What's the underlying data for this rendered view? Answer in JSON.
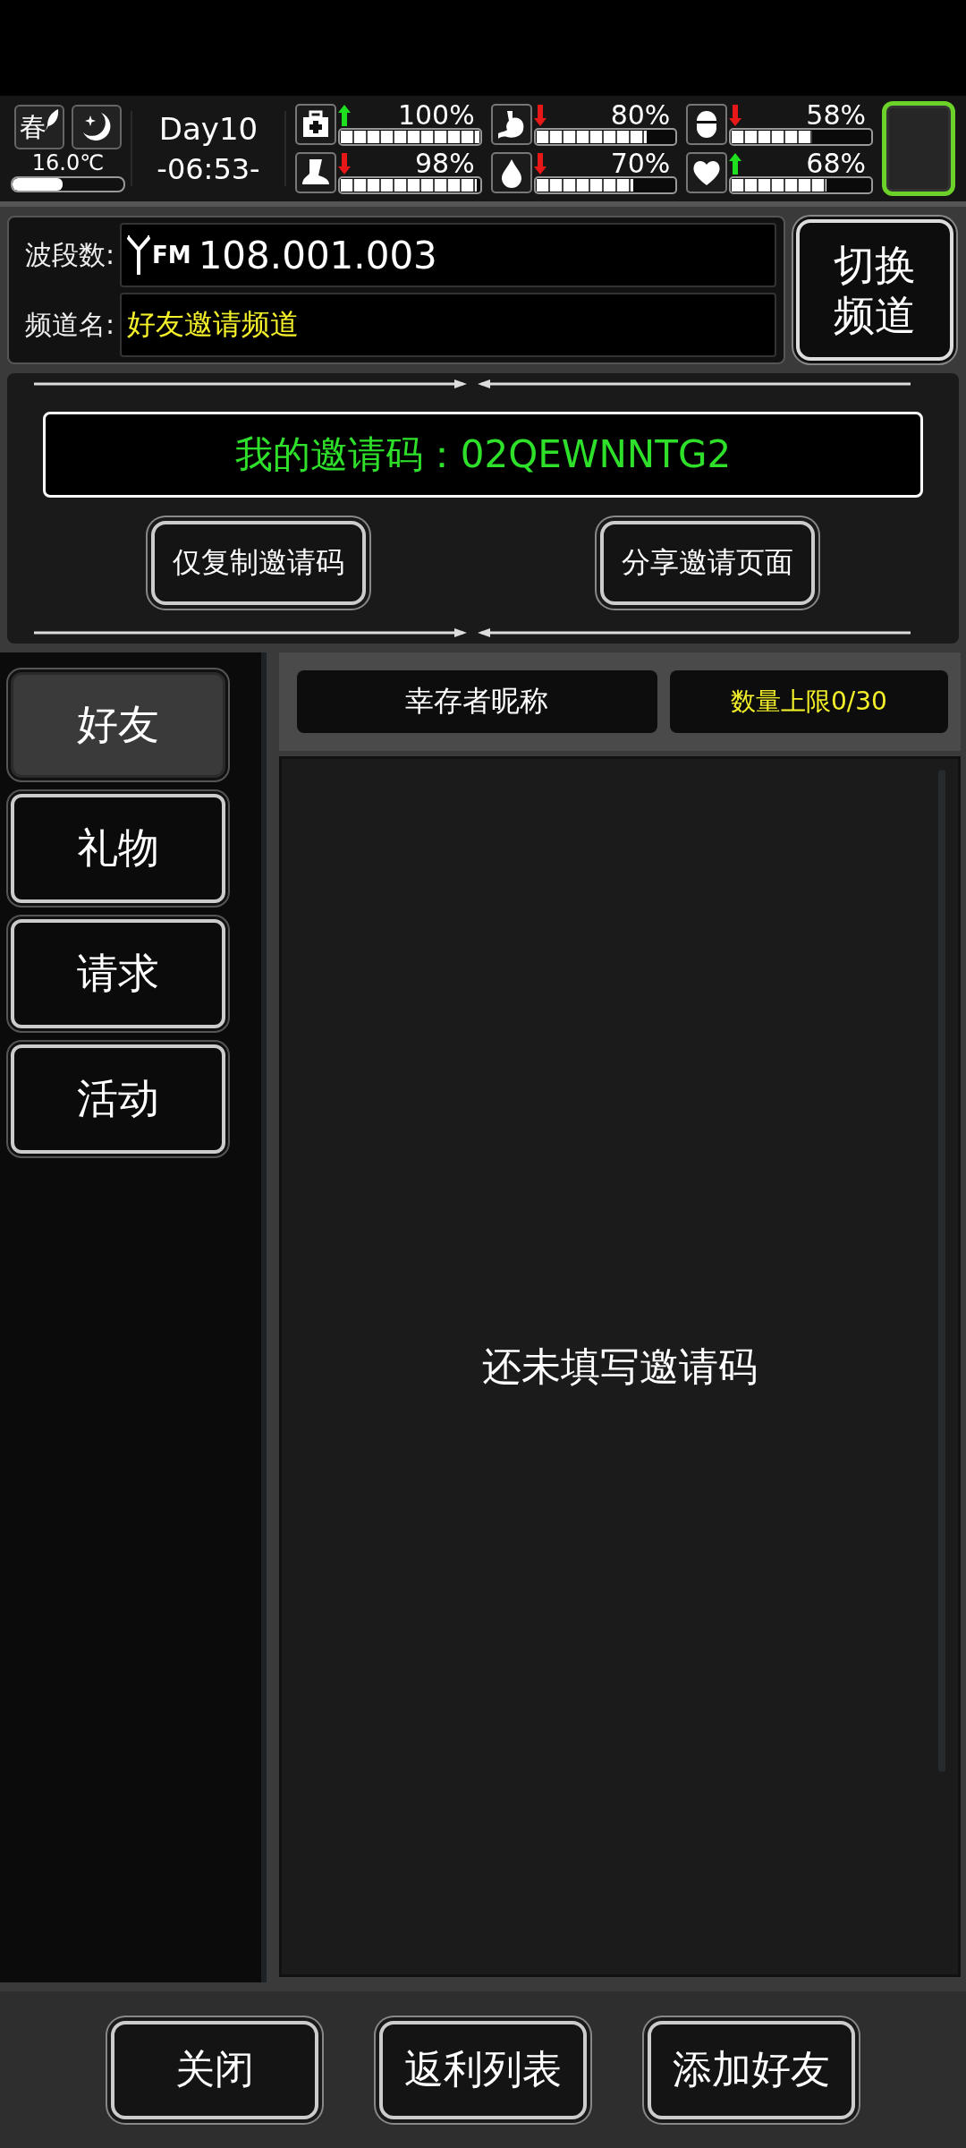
{
  "status": {
    "season": "春",
    "temperature": "16.0℃",
    "temperature_gauge": {
      "level": 0.45
    },
    "day": "Day10",
    "time": "-06:53-",
    "stats": [
      {
        "kind": "health",
        "rising": true,
        "value": "100%",
        "level": 1.0
      },
      {
        "kind": "food",
        "rising": false,
        "value": "80%",
        "level": 0.8
      },
      {
        "kind": "pill",
        "rising": false,
        "value": "58%",
        "level": 0.58
      },
      {
        "kind": "stamina",
        "rising": false,
        "value": "98%",
        "level": 0.98
      },
      {
        "kind": "water",
        "rising": false,
        "value": "70%",
        "level": 0.7
      },
      {
        "kind": "mood",
        "rising": true,
        "value": "68%",
        "level": 0.68
      }
    ]
  },
  "radio": {
    "band_label": "波段数:",
    "band_prefix": "FM",
    "band_value": "108.001.003",
    "channel_label": "频道名:",
    "channel_value": "好友邀请频道",
    "switch_button": "切换频道"
  },
  "invite": {
    "code_text": "我的邀请码：02QEWNNTG2",
    "buttons": [
      "仅复制邀请码",
      "分享邀请页面"
    ]
  },
  "tabs": [
    {
      "label": "好友",
      "selected": true
    },
    {
      "label": "礼物",
      "selected": false
    },
    {
      "label": "请求",
      "selected": false
    },
    {
      "label": "活动",
      "selected": false
    }
  ],
  "list_header": [
    {
      "label": "幸存者昵称",
      "highlight": false
    },
    {
      "label": "数量上限0/30",
      "highlight": true
    }
  ],
  "empty_message": "还未填写邀请码",
  "bottom_buttons": [
    "关闭",
    "返利列表",
    "添加好友"
  ]
}
